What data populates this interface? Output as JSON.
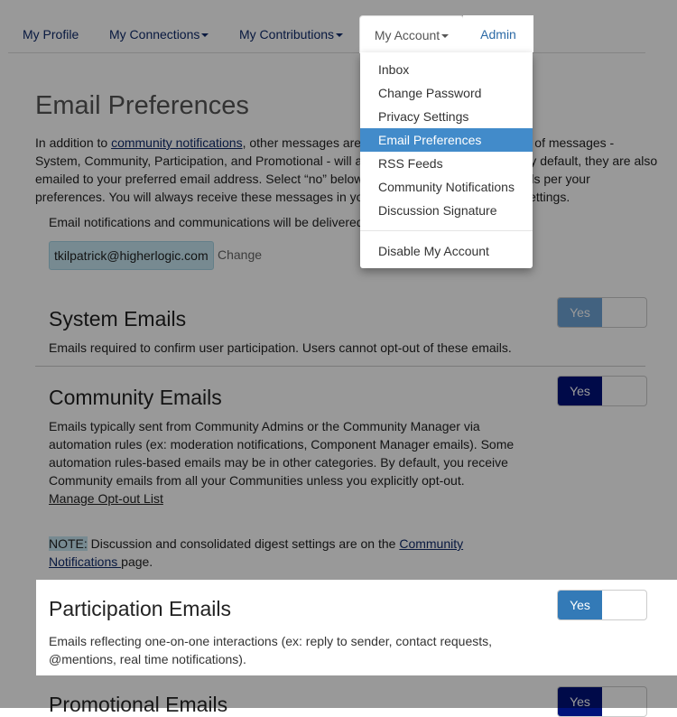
{
  "nav": {
    "items": [
      {
        "label": "My Profile",
        "has_caret": false
      },
      {
        "label": "My Connections",
        "has_caret": true
      },
      {
        "label": "My Contributions",
        "has_caret": true
      },
      {
        "label": "My Account",
        "has_caret": true,
        "open": true
      },
      {
        "label": "Admin",
        "has_caret": false
      }
    ]
  },
  "dropdown": {
    "items": [
      {
        "label": "Inbox"
      },
      {
        "label": "Change Password"
      },
      {
        "label": "Privacy Settings"
      },
      {
        "label": "Email Preferences",
        "active": true
      },
      {
        "label": "RSS Feeds"
      },
      {
        "label": "Community Notifications"
      },
      {
        "label": "Discussion Signature"
      }
    ],
    "footer_item": "Disable My Account"
  },
  "page": {
    "title": "Email Preferences",
    "intro_prefix": "In addition to ",
    "intro_link": "community notifications",
    "intro_rest": ", other messages are sent to your inbox. Four types of messages -System, Community, Participation, and Promotional - will always be sent to your inbox. By default, they are also emailed to your preferred email address. Select “no” below to stop receiving certain emails per your preferences. You will always receive these messages in your inbox regardless of these settings.",
    "deliver_text": "Email notifications and communications will be delivered to:",
    "email": "tkilpatrick@higherlogic.com",
    "change_label": "Change"
  },
  "sections": {
    "system": {
      "title": "System Emails",
      "desc": "Emails required to confirm user participation. Users cannot opt-out of these emails.",
      "toggle": "Yes",
      "color": "#6ea3d6"
    },
    "community": {
      "title": "Community Emails",
      "desc": "Emails typically sent from Community Admins or the Community Manager via automation rules (ex: moderation notifications, Component Manager emails). Some automation rules-based emails may be in other categories. By default, you receive Community emails from all your Communities unless you explicitly opt-out.",
      "manage_link": "Manage Opt-out List",
      "note_label": "NOTE:",
      "note_text": " Discussion and consolidated digest settings are on the ",
      "note_link": "Community Notifications ",
      "note_suffix": "page.",
      "toggle": "Yes",
      "color": "#00127a"
    },
    "participation": {
      "title": "Participation Emails",
      "desc": "Emails reflecting one-on-one interactions (ex: reply to sender, contact requests, @mentions, real time notifications).",
      "toggle": "Yes",
      "color": "#337ab7"
    },
    "promotional": {
      "title": "Promotional Emails",
      "toggle": "Yes",
      "color": "#00127a"
    }
  }
}
